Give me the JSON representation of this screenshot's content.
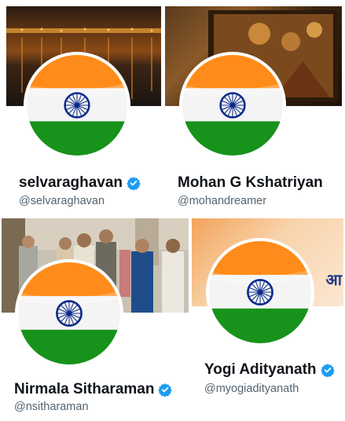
{
  "profiles": [
    {
      "display_name": "selvaraghavan",
      "handle": "@selvaraghavan",
      "verified": true
    },
    {
      "display_name": "Mohan G Kshatriyan",
      "handle": "@mohandreamer",
      "verified": true
    },
    {
      "display_name": "Nirmala Sitharaman",
      "handle": "@nsitharaman",
      "verified": true
    },
    {
      "display_name": "Yogi Adityanath",
      "handle": "@myogiadityanath",
      "verified": true
    }
  ],
  "banner_text_fragment": "आ",
  "colors": {
    "saffron": "#FF9933",
    "green": "#138808",
    "navy": "#000080",
    "verified_blue": "#1d9bf0"
  }
}
